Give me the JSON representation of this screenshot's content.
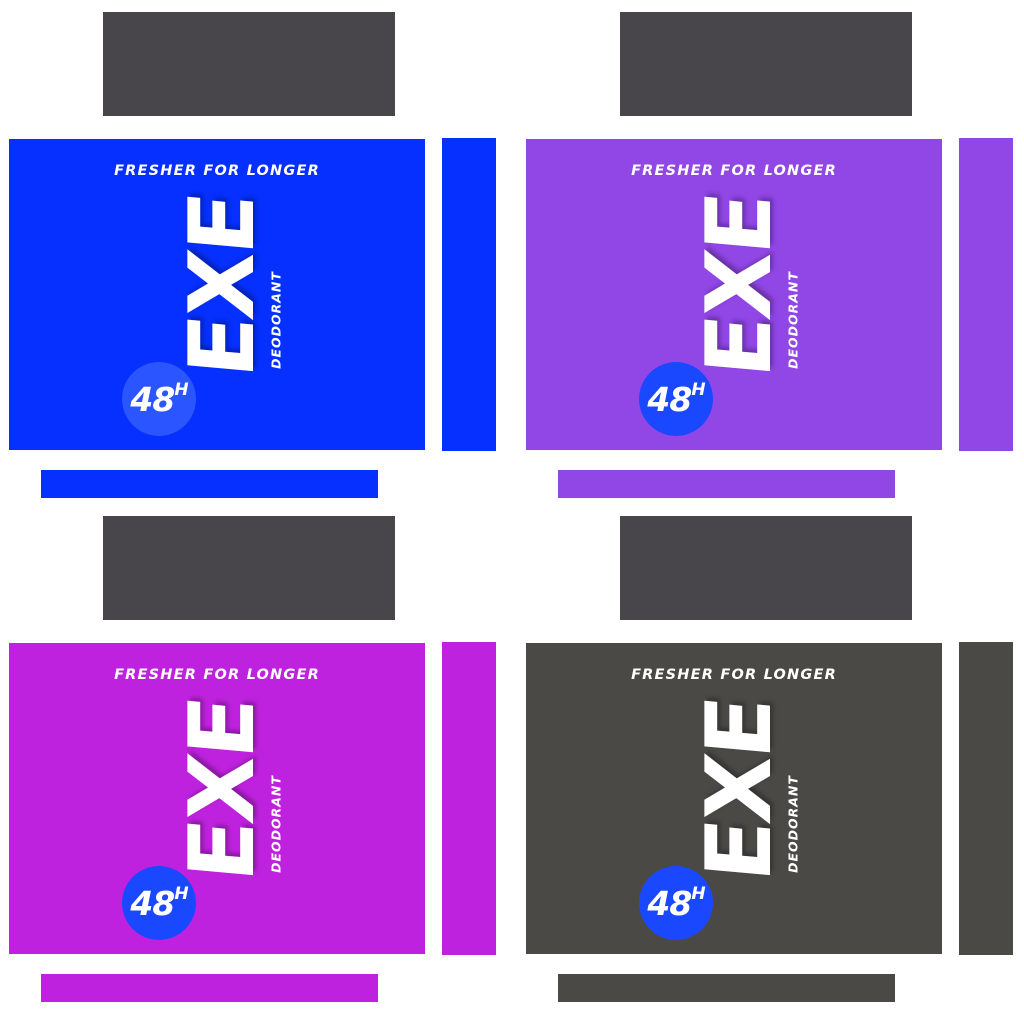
{
  "template": {
    "tagline": "FRESHER FOR LONGER",
    "brand": "EXE",
    "product_type": "DEODORANT",
    "badge_number": "48",
    "badge_unit": "H",
    "lid_color": "#48464b"
  },
  "variants": [
    {
      "box_color": "#0530ff",
      "badge_color": "#2a55ff"
    },
    {
      "box_color": "#9146e6",
      "badge_color": "#1a48ff"
    },
    {
      "box_color": "#bf22de",
      "badge_color": "#1a48ff"
    },
    {
      "box_color": "#4a4946",
      "badge_color": "#1a48ff"
    }
  ]
}
